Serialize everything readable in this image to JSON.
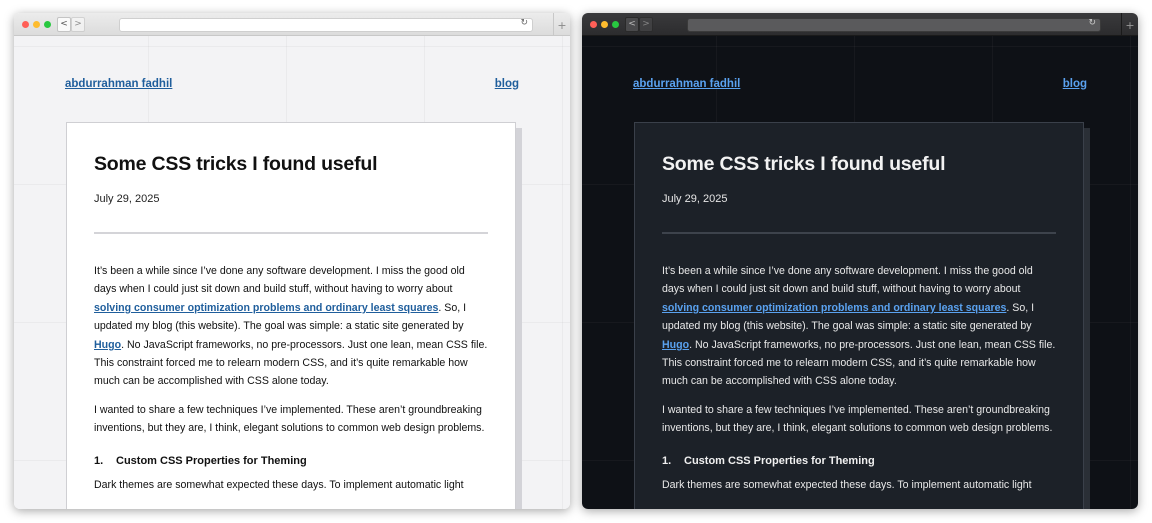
{
  "browser": {
    "nav_back": "<",
    "nav_forward": ">",
    "reload_icon": "↻",
    "new_tab": "+"
  },
  "header": {
    "site_title": "abdurrahman fadhil",
    "nav_link": "blog"
  },
  "post": {
    "title": "Some CSS tricks I found useful",
    "date": "July 29, 2025",
    "p1_part1": "It’s been a while since I’ve done any software development. I miss the good old days when I could just sit down and build stuff, without having to worry about ",
    "p1_link1": "solving consumer optimization problems and ordinary least squares",
    "p1_part2": ". So, I updated my blog (this website). The goal was simple: a static site generated by ",
    "p1_link2": "Hugo",
    "p1_part3": ". No JavaScript frameworks, no pre-processors. Just one lean, mean CSS file. This constraint forced me to relearn modern CSS, and it’s quite remarkable how much can be accomplished with CSS alone today.",
    "p2": "I wanted to share a few techniques I’ve implemented. These aren’t groundbreaking inventions, but they are, I think, elegant solutions to common web design problems.",
    "section1_num": "1.",
    "section1_title": "Custom CSS Properties for Theming",
    "p3": "Dark themes are somewhat expected these days. To implement automatic light"
  },
  "themes": {
    "light": {
      "background": "#f3f3f5",
      "card": "#ffffff",
      "link": "#1f5e9c"
    },
    "dark": {
      "background": "#0e1116",
      "card": "#1c2128",
      "link": "#5aa2f0"
    }
  }
}
